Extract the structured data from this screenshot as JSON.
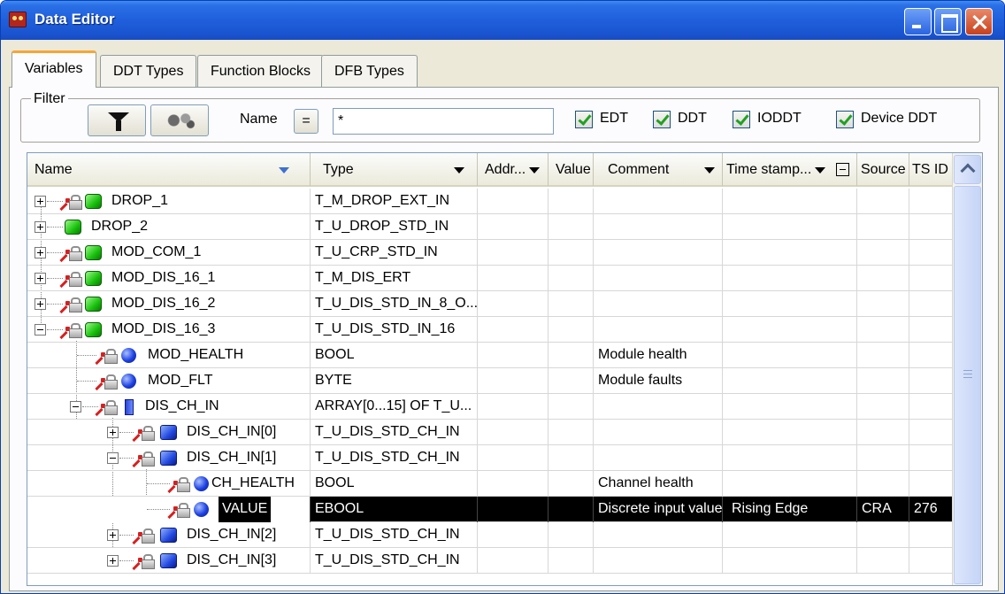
{
  "window": {
    "title": "Data Editor"
  },
  "tabs": [
    "Variables",
    "DDT Types",
    "Function Blocks",
    "DFB Types"
  ],
  "filter": {
    "label": "Filter",
    "name_label": "Name",
    "eq_label": "=",
    "name_value": "*",
    "checkboxes": [
      {
        "label": "EDT",
        "checked": true
      },
      {
        "label": "DDT",
        "checked": true
      },
      {
        "label": "IODDT",
        "checked": true
      },
      {
        "label": "Device DDT",
        "checked": true
      }
    ]
  },
  "columns": [
    "Name",
    "Type",
    "Addr...",
    "Value",
    "Comment",
    "Time stamp...",
    "Source",
    "TS ID"
  ],
  "rows": [
    {
      "name": "DROP_1",
      "type": "T_M_DROP_EXT_IN",
      "comment": "",
      "timestamp": "",
      "source": "",
      "tsid": ""
    },
    {
      "name": "DROP_2",
      "type": "T_U_DROP_STD_IN",
      "comment": "",
      "timestamp": "",
      "source": "",
      "tsid": ""
    },
    {
      "name": "MOD_COM_1",
      "type": "T_U_CRP_STD_IN",
      "comment": "",
      "timestamp": "",
      "source": "",
      "tsid": ""
    },
    {
      "name": "MOD_DIS_16_1",
      "type": "T_M_DIS_ERT",
      "comment": "",
      "timestamp": "",
      "source": "",
      "tsid": ""
    },
    {
      "name": "MOD_DIS_16_2",
      "type": "T_U_DIS_STD_IN_8_O...",
      "comment": "",
      "timestamp": "",
      "source": "",
      "tsid": ""
    },
    {
      "name": "MOD_DIS_16_3",
      "type": "T_U_DIS_STD_IN_16",
      "comment": "",
      "timestamp": "",
      "source": "",
      "tsid": ""
    },
    {
      "name": "MOD_HEALTH",
      "type": "BOOL",
      "comment": "Module health",
      "timestamp": "",
      "source": "",
      "tsid": ""
    },
    {
      "name": "MOD_FLT",
      "type": "BYTE",
      "comment": "Module faults",
      "timestamp": "",
      "source": "",
      "tsid": ""
    },
    {
      "name": "DIS_CH_IN",
      "type": "ARRAY[0...15] OF T_U...",
      "comment": "",
      "timestamp": "",
      "source": "",
      "tsid": ""
    },
    {
      "name": "DIS_CH_IN[0]",
      "type": "T_U_DIS_STD_CH_IN",
      "comment": "",
      "timestamp": "",
      "source": "",
      "tsid": ""
    },
    {
      "name": "DIS_CH_IN[1]",
      "type": "T_U_DIS_STD_CH_IN",
      "comment": "",
      "timestamp": "",
      "source": "",
      "tsid": ""
    },
    {
      "name": "CH_HEALTH",
      "type": "BOOL",
      "comment": "Channel health",
      "timestamp": "",
      "source": "",
      "tsid": ""
    },
    {
      "name": "VALUE",
      "type": "EBOOL",
      "comment": "Discrete input value",
      "timestamp": "Rising Edge",
      "source": "CRA",
      "tsid": "276"
    },
    {
      "name": "DIS_CH_IN[2]",
      "type": "T_U_DIS_STD_CH_IN",
      "comment": "",
      "timestamp": "",
      "source": "",
      "tsid": ""
    },
    {
      "name": "DIS_CH_IN[3]",
      "type": "T_U_DIS_STD_CH_IN",
      "comment": "",
      "timestamp": "",
      "source": "",
      "tsid": ""
    }
  ]
}
